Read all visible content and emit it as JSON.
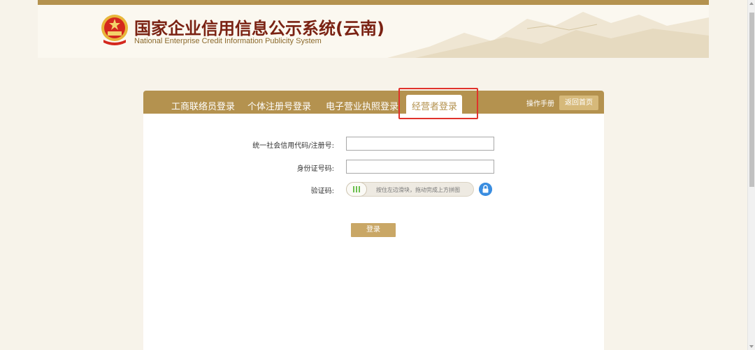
{
  "header": {
    "title": "国家企业信用信息公示系统(云南)",
    "subtitle": "National Enterprise Credit Information Publicity System"
  },
  "tabs": [
    {
      "label": "工商联络员登录"
    },
    {
      "label": "个体注册号登录"
    },
    {
      "label": "电子营业执照登录"
    },
    {
      "label": "经营者登录",
      "active": true
    }
  ],
  "toolbar": {
    "manual_label": "操作手册",
    "home_label": "返回首页"
  },
  "form": {
    "credit_code_label": "统一社会信用代码/注册号:",
    "credit_code_value": "",
    "id_label": "身份证号码:",
    "id_value": "",
    "captcha_label": "验证码:",
    "slider_hint": "按住左边滑块，拖动完成上方拼图",
    "login_label": "登录"
  },
  "colors": {
    "brand": "#b4924f",
    "highlight": "#e0322b",
    "lock": "#3a8de0",
    "slider_grip": "#6bbf4e"
  },
  "icons": [
    "national-emblem-icon",
    "lock-icon",
    "slider-grip-icon"
  ]
}
